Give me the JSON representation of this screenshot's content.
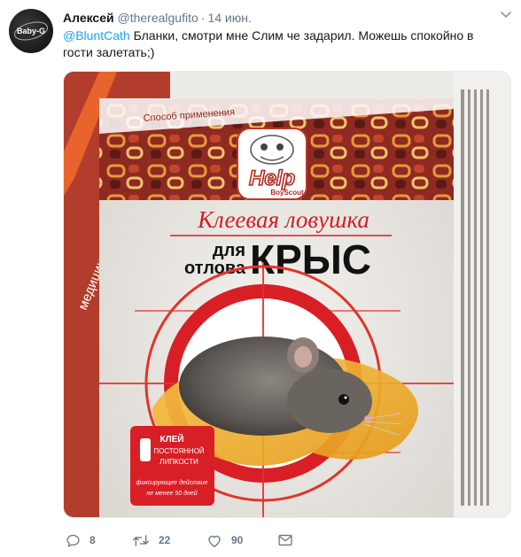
{
  "tweet": {
    "author_name": "Алексей",
    "author_handle": "@therealgufito",
    "separator": "·",
    "time": "14 июн.",
    "mention": "@BluntCath",
    "text": "Бланки, смотри мне Слим че задарил. Можешь спокойно в гости залетать;)",
    "avatar_text": "Baby-G"
  },
  "media": {
    "side_text": "медицинской дезинсекции",
    "tab_text": "Способ применения",
    "logo_text": "Help",
    "logo_sub": "BoyScout",
    "title_script": "Клеевая ловушка",
    "title_line1": "для",
    "title_line2": "отлова",
    "title_big": "КРЫС",
    "badge_line1": "КЛЕЙ",
    "badge_line2": "ПОСТОЯННОЙ",
    "badge_line3": "ЛИПКОСТИ",
    "badge_line4": "фиксирующее действие",
    "badge_line5": "не менее 50 дней"
  },
  "actions": {
    "replies": "8",
    "retweets": "22",
    "likes": "90"
  },
  "icons": [
    "caret-down-icon",
    "reply-icon",
    "retweet-icon",
    "like-icon",
    "direct-message-icon"
  ],
  "colors": {
    "link": "#1da1f2",
    "secondary_text": "#657786",
    "box_red": "#d81f26",
    "box_orange": "#e8642c"
  }
}
